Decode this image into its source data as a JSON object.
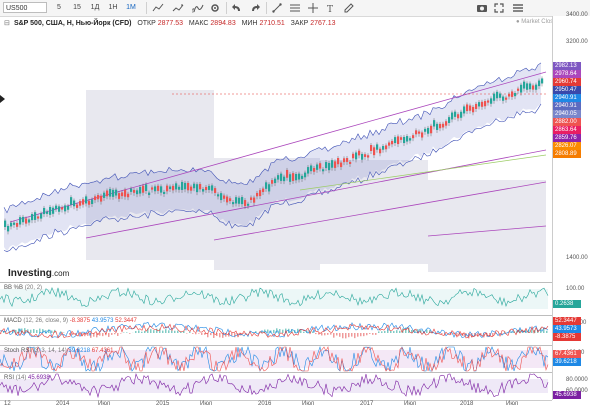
{
  "toolbar": {
    "symbol": "US500",
    "timeframes": [
      "5",
      "15",
      "1Д",
      "1Н",
      "1М"
    ],
    "active_timeframe": "1Н",
    "icons": [
      "add-symbol-icon",
      "line-chart-icon",
      "compare-icon",
      "indicators-icon",
      "settings-icon",
      "undo-icon",
      "redo-icon",
      "trend-line-icon",
      "fibonacci-icon",
      "crosshair-icon",
      "text-icon",
      "draw-icon",
      "screenshot-icon",
      "fullscreen-icon",
      "menu-icon"
    ]
  },
  "legend": {
    "name": "S&P 500, США, Н, Нью-Йорк (CFD)",
    "open_label": "ОТКР",
    "open_value": "2877.53",
    "high_label": "МАКС",
    "high_value": "2894.83",
    "low_label": "МИН",
    "low_value": "2710.51",
    "close_label": "ЗАКР",
    "close_value": "2767.13",
    "market_status": "Market Closed"
  },
  "price_axis": {
    "ticks": [
      "3400.00",
      "3200.00",
      "1400.00",
      "-100.00",
      "100.00",
      "100.00",
      "80.0000",
      "60.0000"
    ],
    "price_tags": [
      {
        "value": "2982.13",
        "color": "#7e57c2"
      },
      {
        "value": "2978.64",
        "color": "#ab47bc"
      },
      {
        "value": "2960.74",
        "color": "#e53935"
      },
      {
        "value": "2950.47",
        "color": "#3949ab"
      },
      {
        "value": "2940.91",
        "color": "#1e88e5"
      },
      {
        "value": "2940.91",
        "color": "#5c6bc0"
      },
      {
        "value": "2940.05",
        "color": "#7986cb"
      },
      {
        "value": "2882.00",
        "color": "#ef5350"
      },
      {
        "value": "2863.64",
        "color": "#e91e63"
      },
      {
        "value": "2859.76",
        "color": "#8e24aa"
      },
      {
        "value": "2826.07",
        "color": "#fb8c00"
      },
      {
        "value": "2808.89",
        "color": "#f57c00"
      }
    ]
  },
  "brand": {
    "name": "Investing",
    "suffix": ".com"
  },
  "indicators": [
    {
      "name": "BB %B",
      "config": "(20, 2)",
      "tags": [
        {
          "value": "0.2638",
          "color": "#26a69a"
        }
      ]
    },
    {
      "name": "MACD",
      "config": "(12, 26, close, 9)",
      "values": [
        "-8.3875",
        "43.9573",
        "52.3447"
      ],
      "tags": [
        {
          "value": "52.3447",
          "color": "#e53935"
        },
        {
          "value": "43.9573",
          "color": "#1e88e5"
        },
        {
          "value": "-8.3875",
          "color": "#e53935"
        }
      ]
    },
    {
      "name": "Stoch RSI",
      "config": "(3, 3, 14, 14)",
      "values": [
        "39.6218",
        "67.4361"
      ],
      "tags": [
        {
          "value": "67.4361",
          "color": "#ef5350"
        },
        {
          "value": "39.6218",
          "color": "#1e88e5"
        }
      ]
    },
    {
      "name": "RSI",
      "config": "(14)",
      "values": [
        "45.6938"
      ],
      "tags": [
        {
          "value": "45.6938",
          "color": "#7b1fa2"
        }
      ]
    }
  ],
  "time_axis": {
    "labels": [
      "12",
      "2014",
      "Июл",
      "2015",
      "Июл",
      "2016",
      "Июл",
      "2017",
      "Июл",
      "2018",
      "Июл"
    ]
  },
  "colors": {
    "candle_up": "#26a69a",
    "candle_down": "#ef5350",
    "bands": "#3f51b5",
    "envelope": "#ab47bc"
  }
}
